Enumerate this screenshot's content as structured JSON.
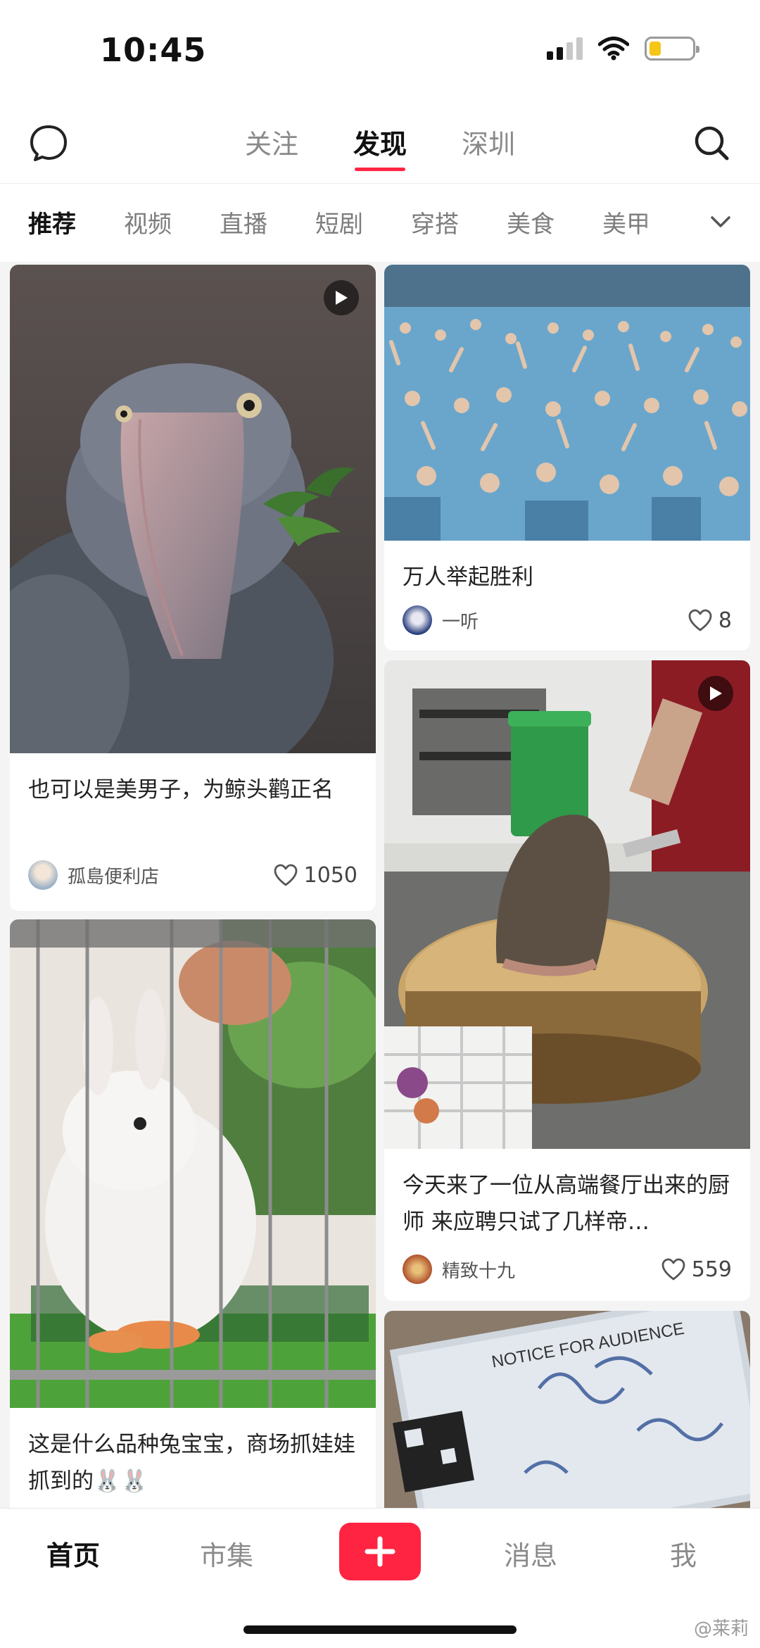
{
  "status_bar": {
    "time": "10:45",
    "battery_level": 0.28
  },
  "top_nav": {
    "tabs": [
      {
        "label": "关注",
        "active": false
      },
      {
        "label": "发现",
        "active": true
      },
      {
        "label": "深圳",
        "active": false
      }
    ]
  },
  "categories": [
    {
      "label": "推荐",
      "active": true
    },
    {
      "label": "视频"
    },
    {
      "label": "直播"
    },
    {
      "label": "短剧"
    },
    {
      "label": "穿搭"
    },
    {
      "label": "美食"
    },
    {
      "label": "美甲"
    }
  ],
  "feed": {
    "left": [
      {
        "title": "也可以是美男子，为鲸头鹳正名",
        "author": "孤島便利店",
        "likes": "1050",
        "is_video": true
      },
      {
        "title": "这是什么品种兔宝宝，商场抓娃娃抓到的🐰🐰",
        "is_video": false
      }
    ],
    "right": [
      {
        "title": "万人举起胜利",
        "author": "一听",
        "likes": "8",
        "is_video": false
      },
      {
        "title": "今天来了一位从高端餐厅出来的厨师 来应聘只试了几样帝…",
        "author": "精致十九",
        "likes": "559",
        "is_video": true
      },
      {
        "ticket_text": "NOTICE FOR AUDIENCE"
      }
    ]
  },
  "bottom_nav": {
    "home": "首页",
    "market": "市集",
    "publish": "+",
    "messages": "消息",
    "me": "我"
  },
  "watermark": "@莱莉"
}
